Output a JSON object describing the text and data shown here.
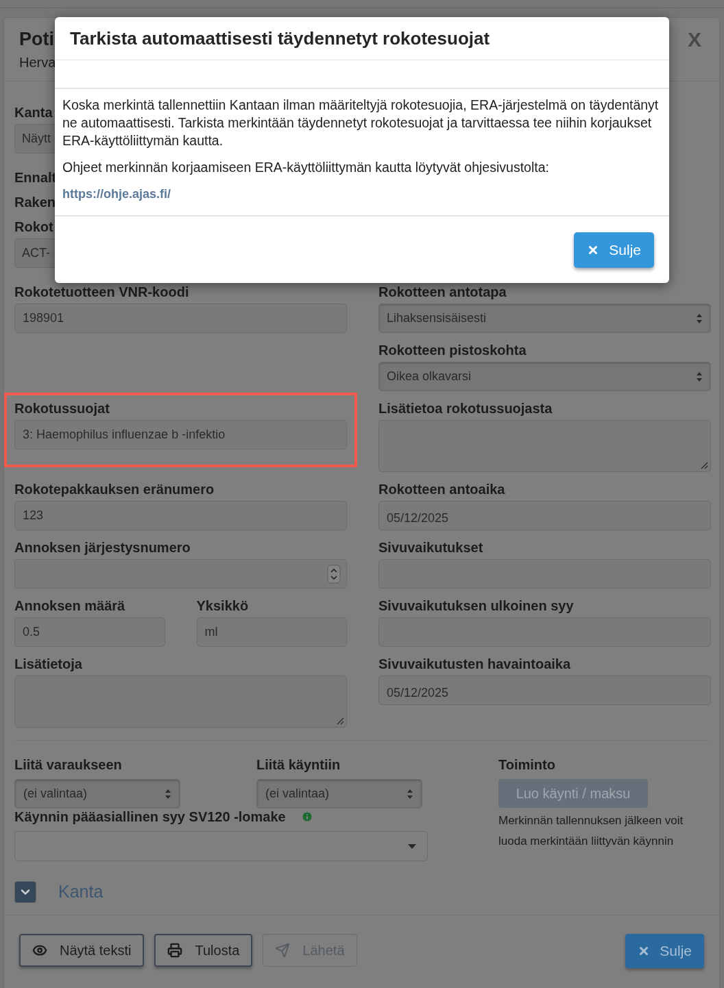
{
  "background_dialog": {
    "title": "Poti",
    "subtitle": "Herva",
    "close": "X",
    "cut_fields": [
      {
        "label": "Kanta",
        "value": "Näytt"
      },
      {
        "label": "Ennalt"
      },
      {
        "label": "Raken"
      },
      {
        "label": "Rokot",
        "value": "ACT-"
      }
    ],
    "rows": [
      {
        "left": {
          "kind": "stack",
          "fields": [
            {
              "label": "Rokotetuotteen VNR-koodi",
              "value": "198901",
              "kind": "text",
              "highlighted": false
            }
          ]
        },
        "right": {
          "kind": "stack",
          "fields": [
            {
              "label": "Rokotteen antotapa",
              "value": "Lihaksensisäisesti",
              "kind": "select",
              "highlighted": false
            },
            {
              "label": "Rokotteen pistoskohta",
              "value": "Oikea olkavarsi",
              "kind": "select",
              "highlighted": false
            }
          ]
        }
      },
      {
        "left": {
          "kind": "stack",
          "fields": [
            {
              "label": "Rokotussuojat",
              "value": "3: Haemophilus influenzae b -infektio",
              "kind": "text",
              "highlighted": true
            }
          ]
        },
        "right": {
          "kind": "stack",
          "fields": [
            {
              "label": "Lisätietoa rokotussuojasta",
              "kind": "textarea",
              "highlighted": false
            }
          ]
        }
      },
      {
        "left": {
          "kind": "stack",
          "fields": [
            {
              "label": "Rokotepakkauksen eränumero",
              "value": "123",
              "kind": "text",
              "highlighted": false
            }
          ]
        },
        "right": {
          "kind": "stack",
          "fields": [
            {
              "label": "Rokotteen antoaika",
              "value": "05/12/2025",
              "kind": "date",
              "highlighted": false
            }
          ]
        }
      },
      {
        "left": {
          "kind": "stack",
          "fields": [
            {
              "label": "Annoksen järjestysnumero",
              "kind": "number",
              "highlighted": false
            }
          ]
        },
        "right": {
          "kind": "stack",
          "fields": [
            {
              "label": "Sivuvaikutukset",
              "kind": "text",
              "highlighted": false
            }
          ]
        }
      },
      {
        "left": {
          "kind": "split",
          "fields": [
            {
              "label": "Annoksen määrä",
              "value": "0.5",
              "kind": "text",
              "highlighted": false
            },
            {
              "label": "Yksikkö",
              "value": "ml",
              "kind": "text",
              "highlighted": false
            }
          ]
        },
        "right": {
          "kind": "stack",
          "fields": [
            {
              "label": "Sivuvaikutuksen ulkoinen syy",
              "kind": "text",
              "highlighted": false
            }
          ]
        }
      },
      {
        "left": {
          "kind": "stack",
          "fields": [
            {
              "label": "Lisätietoja",
              "kind": "textarea",
              "highlighted": false
            }
          ]
        },
        "right": {
          "kind": "stack",
          "fields": [
            {
              "label": "Sivuvaikutusten havaintoaika",
              "value": "05/12/2025",
              "kind": "date",
              "highlighted": false
            }
          ]
        }
      }
    ],
    "link_booking": {
      "label": "Liitä varaukseen",
      "value": "(ei valintaa)"
    },
    "link_visit": {
      "label": "Liitä käyntiin",
      "value": "(ei valintaa)"
    },
    "action": {
      "label": "Toiminto",
      "button": "Luo käynti / maksu",
      "disabled": true,
      "help": "Merkinnän tallennuksen jälkeen voit luoda merkintään liittyvän käynnin"
    },
    "reason": {
      "label": "Käynnin pääasiallinen syy SV120 -lomake"
    },
    "kanta_section": {
      "title": "Kanta",
      "expanded": false
    },
    "footer_buttons": [
      {
        "label": "Näytä teksti",
        "disabled": false
      },
      {
        "label": "Tulosta",
        "disabled": false
      },
      {
        "label": "Lähetä",
        "disabled": true
      }
    ],
    "close_button": "Sulje"
  },
  "modal": {
    "title": "Tarkista automaattisesti täydennetyt rokotesuojat",
    "paragraphs": [
      "Koska merkintä tallennettiin Kantaan ilman määriteltyjä rokotesuojia, ERA-järjestelmä on täydentänyt ne automaattisesti. Tarkista merkintään täydennetyt rokotesuojat ja tarvittaessa tee niihin korjaukset ERA-käyttöliittymän kautta.",
      "Ohjeet merkinnän korjaamiseen ERA-käyttöliittymän kautta löytyvät ohjesivustolta:"
    ],
    "link": "https://ohje.ajas.fi/",
    "close_button": "Sulje"
  }
}
